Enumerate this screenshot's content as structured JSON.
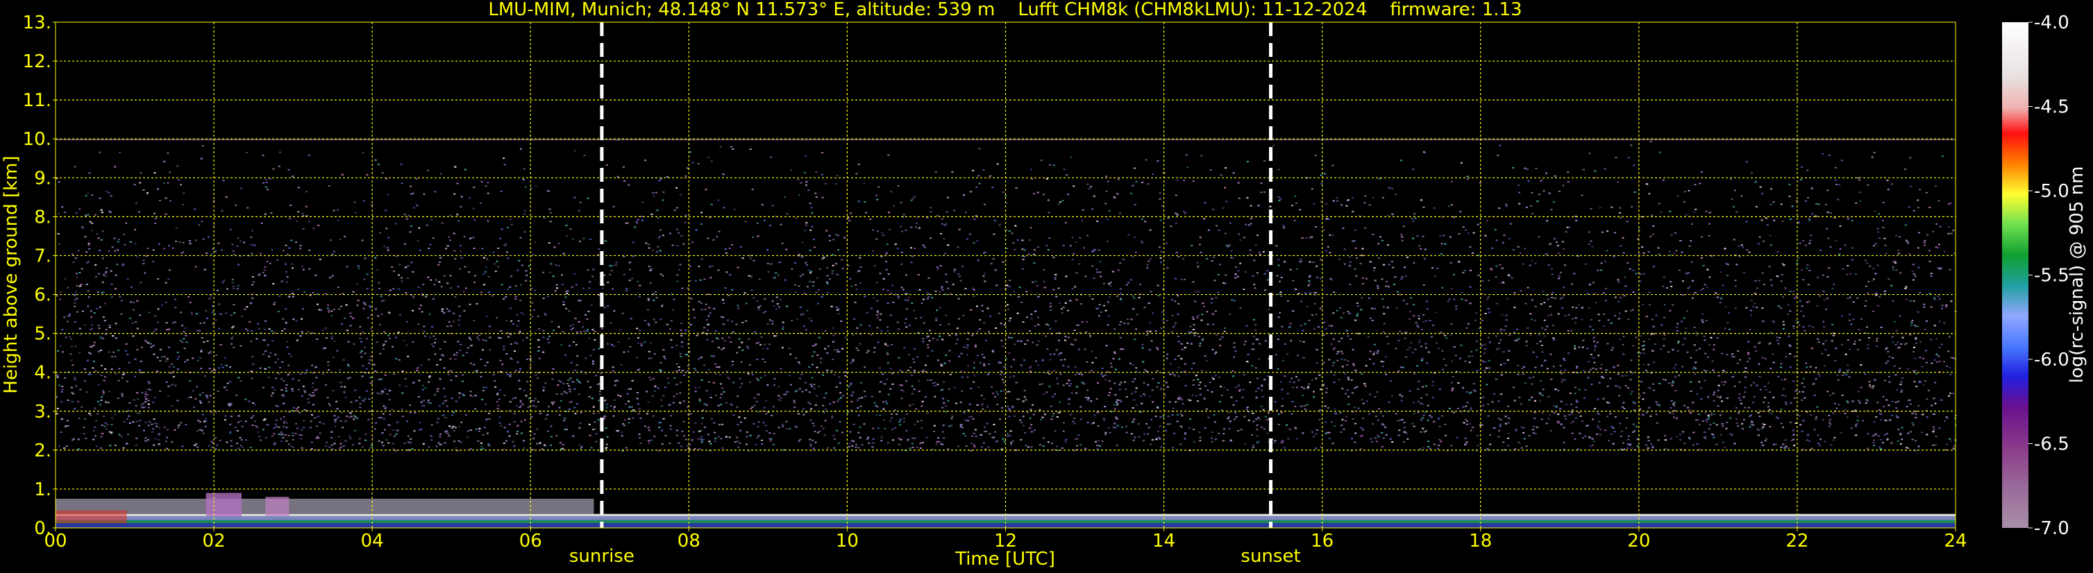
{
  "chart_data": {
    "type": "heatmap",
    "title": "LMU-MIM, Munich; 48.148° N 11.573° E, altitude: 539 m    Lufft CHM8k (CHM8kLMU): 11-12-2024    firmware: 1.13",
    "xlabel": "Time [UTC]",
    "ylabel": "Height above ground [km]",
    "xlim": [
      0,
      24
    ],
    "ylim": [
      0,
      13
    ],
    "x_ticks": [
      "00",
      "02",
      "04",
      "06",
      "08",
      "10",
      "12",
      "14",
      "16",
      "18",
      "20",
      "22",
      "24"
    ],
    "y_ticks": [
      "0.",
      "1.",
      "2.",
      "3.",
      "4.",
      "5.",
      "6.",
      "7.",
      "8.",
      "9.",
      "10.",
      "11.",
      "12.",
      "13."
    ],
    "grid": true,
    "markers": [
      {
        "label": "sunrise",
        "time": 6.9
      },
      {
        "label": "sunset",
        "time": 15.35
      }
    ],
    "signal_top_km": 10.0,
    "colorbar": {
      "label": "log(rc-signal) @ 905 nm",
      "range": [
        -7.0,
        -4.0
      ],
      "ticks": [
        "-4.0",
        "-4.5",
        "-5.0",
        "-5.5",
        "-6.0",
        "-6.5",
        "-7.0"
      ]
    }
  },
  "colors": {
    "text": "#ffff00",
    "grid": "#ffff00",
    "marker": "#ffffff",
    "background": "#000000"
  }
}
